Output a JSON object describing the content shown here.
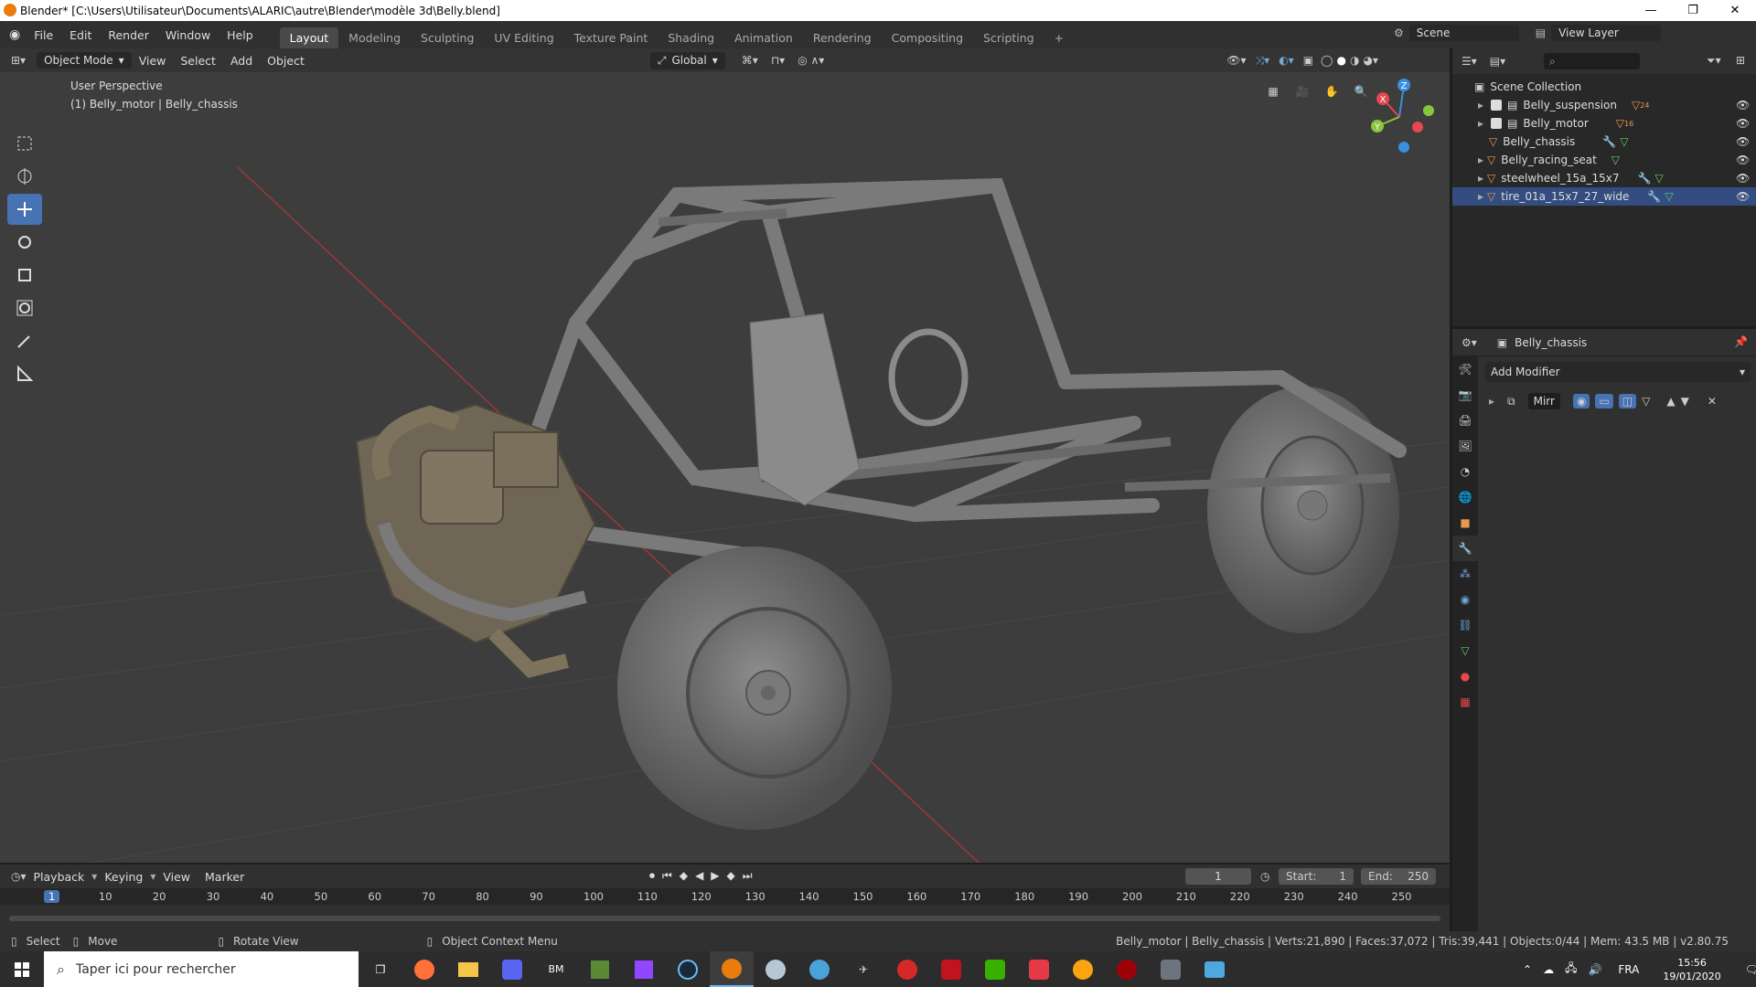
{
  "window": {
    "title": "Blender* [C:\\Users\\Utilisateur\\Documents\\ALARIC\\autre\\Blender\\modèle 3d\\Belly.blend]"
  },
  "menus": [
    "File",
    "Edit",
    "Render",
    "Window",
    "Help"
  ],
  "workspaces": [
    "Layout",
    "Modeling",
    "Sculpting",
    "UV Editing",
    "Texture Paint",
    "Shading",
    "Animation",
    "Rendering",
    "Compositing",
    "Scripting"
  ],
  "active_workspace": "Layout",
  "scene": {
    "label": "Scene",
    "view_layer": "View Layer"
  },
  "viewport": {
    "mode": "Object Mode",
    "menu": [
      "View",
      "Select",
      "Add",
      "Object"
    ],
    "transform_orientation": "Global",
    "info_line1": "User Perspective",
    "info_line2": "(1) Belly_motor | Belly_chassis",
    "gizmo": {
      "x": "X",
      "y": "Y",
      "z": "Z"
    }
  },
  "outliner": {
    "root": "Scene Collection",
    "items": [
      {
        "name": "Belly_suspension",
        "type": "collection",
        "badge": "24"
      },
      {
        "name": "Belly_motor",
        "type": "collection",
        "badge": "16"
      },
      {
        "name": "Belly_chassis",
        "type": "object"
      },
      {
        "name": "Belly_racing_seat",
        "type": "object"
      },
      {
        "name": "steelwheel_15a_15x7",
        "type": "object"
      },
      {
        "name": "tire_01a_15x7_27_wide",
        "type": "object",
        "selected": true
      }
    ]
  },
  "properties": {
    "object": "Belly_chassis",
    "add_modifier": "Add Modifier",
    "modifier_name": "Mirr"
  },
  "timeline": {
    "menu": [
      "Playback",
      "Keying",
      "View",
      "Marker"
    ],
    "current_frame": "1",
    "start_label": "Start:",
    "start": "1",
    "end_label": "End:",
    "end": "250",
    "ticks": [
      "1",
      "10",
      "20",
      "30",
      "40",
      "50",
      "60",
      "70",
      "80",
      "90",
      "100",
      "110",
      "120",
      "130",
      "140",
      "150",
      "160",
      "170",
      "180",
      "190",
      "200",
      "210",
      "220",
      "230",
      "240",
      "250"
    ]
  },
  "statusbar": {
    "select": "Select",
    "move": "Move",
    "rotate": "Rotate View",
    "context": "Object Context Menu",
    "stats": "Belly_motor | Belly_chassis | Verts:21,890 | Faces:37,072 | Tris:39,441 | Objects:0/44 | Mem: 43.5 MB | v2.80.75"
  },
  "taskbar": {
    "search_placeholder": "Taper ici pour rechercher",
    "lang": "FRA",
    "time": "15:56",
    "date": "19/01/2020"
  },
  "colors": {
    "accent": "#4772b3",
    "selected_row": "#334d80",
    "collection_icon": "#e89b4a",
    "mesh_icon": "#66cc66",
    "axis_x": "#e5484d",
    "axis_y": "#8ac53e",
    "axis_z": "#3b8ee0"
  }
}
